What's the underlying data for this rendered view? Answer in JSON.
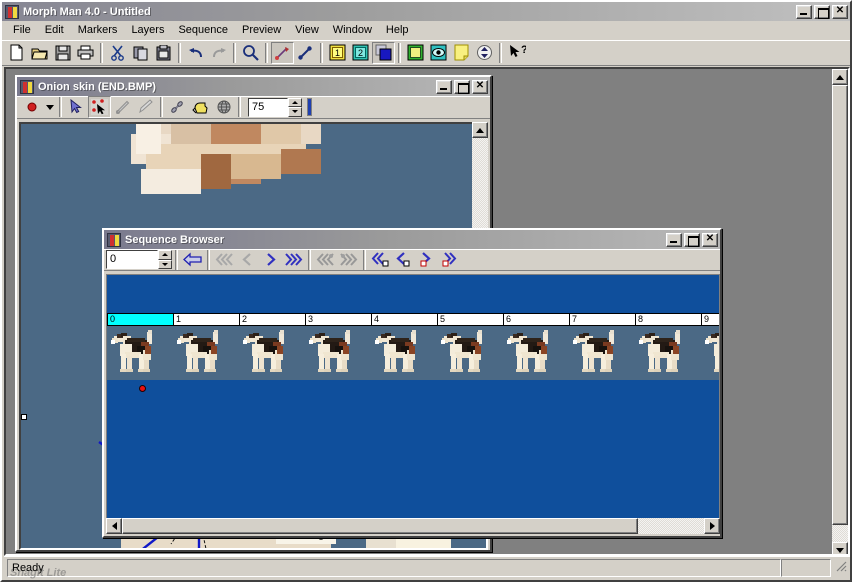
{
  "app": {
    "title": "Morph Man 4.0 - Untitled",
    "icon": "morphman-icon",
    "window_buttons": {
      "minimize": "_",
      "maximize": "□",
      "close": "✕"
    }
  },
  "menu": {
    "items": [
      {
        "label": "File"
      },
      {
        "label": "Edit"
      },
      {
        "label": "Markers"
      },
      {
        "label": "Layers"
      },
      {
        "label": "Sequence"
      },
      {
        "label": "Preview"
      },
      {
        "label": "View"
      },
      {
        "label": "Window"
      },
      {
        "label": "Help"
      }
    ]
  },
  "toolbar": {
    "buttons": [
      {
        "name": "new-file-icon",
        "glyph": "📄",
        "enabled": true
      },
      {
        "name": "open-folder-icon",
        "glyph": "📂",
        "enabled": true
      },
      {
        "name": "save-disk-icon",
        "glyph": "💾",
        "enabled": true
      },
      {
        "name": "print-icon",
        "glyph": "🖨",
        "enabled": true
      },
      {
        "name": "cut-scissors-icon",
        "glyph": "✂",
        "enabled": true
      },
      {
        "name": "copy-icon",
        "glyph": "⧉",
        "enabled": true
      },
      {
        "name": "paste-icon",
        "glyph": "📋",
        "enabled": true
      },
      {
        "name": "undo-icon",
        "glyph": "↶",
        "enabled": true
      },
      {
        "name": "redo-icon",
        "glyph": "↷",
        "enabled": false
      },
      {
        "name": "zoom-magnifier-icon",
        "glyph": "🔍",
        "enabled": true
      },
      {
        "name": "marker-pen-icon",
        "glyph": "✎",
        "enabled": true
      },
      {
        "name": "marker-link-icon",
        "glyph": "⟋",
        "enabled": true
      },
      {
        "name": "layer-one-icon",
        "glyph": "1",
        "enabled": true
      },
      {
        "name": "layer-two-icon",
        "glyph": "2",
        "enabled": true
      },
      {
        "name": "layer-blend-icon",
        "glyph": "▦",
        "enabled": true
      },
      {
        "name": "onion-skin-icon",
        "glyph": "▣",
        "enabled": true
      },
      {
        "name": "preview-eye-icon",
        "glyph": "◉",
        "enabled": true
      },
      {
        "name": "note-icon",
        "glyph": "▢",
        "enabled": true
      },
      {
        "name": "morph-updown-icon",
        "glyph": "⇕",
        "enabled": true
      },
      {
        "name": "help-pointer-icon",
        "glyph": "?",
        "enabled": true
      }
    ]
  },
  "onion_window": {
    "title": "Onion skin (END.BMP)",
    "window_buttons": {
      "minimize": "_",
      "maximize": "□",
      "close": "✕"
    },
    "toolbar": {
      "marker_color_label": "●",
      "dropdown_arrow": "▾",
      "opacity_value": "75",
      "buttons": [
        {
          "name": "marker-color-swatch",
          "enabled": true
        },
        {
          "name": "marker-color-dropdown-icon",
          "enabled": true
        },
        {
          "name": "select-arrow-tool",
          "enabled": true,
          "pressed": false
        },
        {
          "name": "select-markers-tool",
          "enabled": true,
          "pressed": true
        },
        {
          "name": "pen-tool",
          "enabled": false,
          "pressed": false
        },
        {
          "name": "eraser-tool",
          "enabled": false,
          "pressed": false
        },
        {
          "name": "chain-link-tool",
          "enabled": true,
          "pressed": false
        },
        {
          "name": "hand-pan-tool",
          "enabled": true,
          "pressed": false
        },
        {
          "name": "mesh-globe-tool",
          "enabled": true,
          "pressed": false
        }
      ]
    }
  },
  "sequence_browser": {
    "title": "Sequence Browser",
    "window_buttons": {
      "minimize": "_",
      "maximize": "□",
      "close": "✕"
    },
    "frame_value": "0",
    "nav_buttons": [
      {
        "name": "nav-back-arrow",
        "glyph": "⇦",
        "enabled": true,
        "badge": "none"
      },
      {
        "name": "nav-first-frame",
        "glyph": "⋘",
        "enabled": false,
        "badge": "none"
      },
      {
        "name": "nav-prev-frame",
        "glyph": "❮",
        "enabled": false,
        "badge": "none"
      },
      {
        "name": "nav-next-frame",
        "glyph": "❯",
        "enabled": true,
        "badge": "none"
      },
      {
        "name": "nav-last-frame",
        "glyph": "⋙",
        "enabled": true,
        "badge": "none"
      },
      {
        "name": "nav-prev-key-disabled",
        "glyph": "⋘",
        "enabled": false,
        "badge": "none"
      },
      {
        "name": "nav-next-key-disabled",
        "glyph": "⋙",
        "enabled": false,
        "badge": "none"
      },
      {
        "name": "nav-first-marked",
        "glyph": "⋘",
        "enabled": true,
        "badge": "white"
      },
      {
        "name": "nav-prev-marked",
        "glyph": "❮",
        "enabled": true,
        "badge": "white"
      },
      {
        "name": "nav-next-marked",
        "glyph": "❯",
        "enabled": true,
        "badge": "red"
      },
      {
        "name": "nav-last-marked",
        "glyph": "⋙",
        "enabled": true,
        "badge": "red"
      }
    ],
    "ruler": {
      "cells": [
        {
          "label": "0",
          "selected": true
        },
        {
          "label": "1",
          "selected": false
        },
        {
          "label": "2",
          "selected": false
        },
        {
          "label": "3",
          "selected": false
        },
        {
          "label": "4",
          "selected": false
        },
        {
          "label": "5",
          "selected": false
        },
        {
          "label": "6",
          "selected": false
        },
        {
          "label": "7",
          "selected": false
        },
        {
          "label": "8",
          "selected": false
        },
        {
          "label": "9",
          "selected": false
        }
      ]
    },
    "thumbnails": {
      "count": 10,
      "subject": "wire-fox-terrier-dog"
    },
    "marker_dot": {
      "name": "red-marker-dot",
      "color": "#e81010"
    }
  },
  "statusbar": {
    "message": "Ready",
    "watermark": "SnagIt Lite"
  },
  "colors": {
    "window_face": "#d4d0c8",
    "mdi_background": "#808080",
    "sequence_canvas": "#0f4f9c",
    "onion_canvas": "#4b6985",
    "ruler_selected": "#00ffff",
    "marker_line": "#0000cc",
    "accent_title": "#8a8a99"
  }
}
